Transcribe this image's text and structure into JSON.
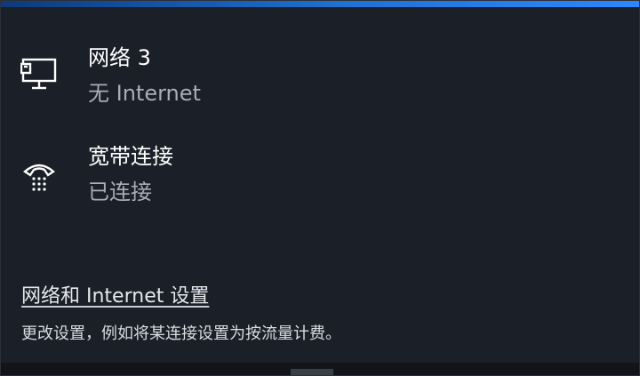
{
  "window": {
    "accent_color": "#2e86ff",
    "background_color": "#1b1f27"
  },
  "connections": [
    {
      "icon": "ethernet-monitor-icon",
      "name": "网络 3",
      "status": "无 Internet"
    },
    {
      "icon": "dialup-phone-icon",
      "name": "宽带连接",
      "status": "已连接"
    }
  ],
  "settings": {
    "link_label": "网络和 Internet 设置",
    "description": "更改设置，例如将某连接设置为按流量计费。"
  }
}
